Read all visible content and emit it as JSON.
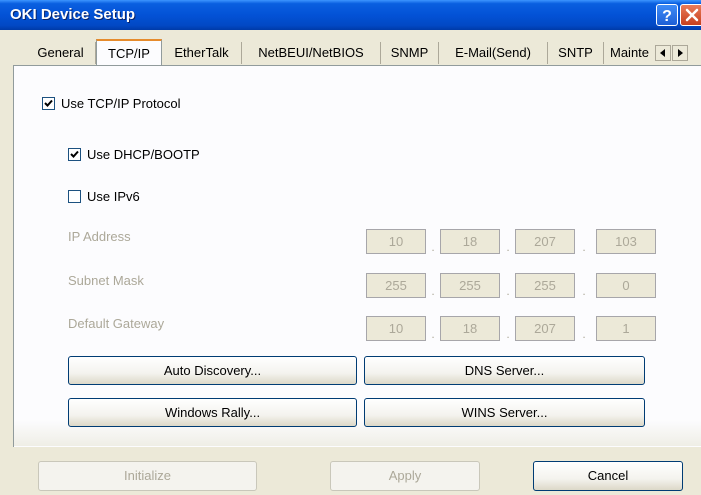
{
  "window": {
    "title": "OKI Device Setup"
  },
  "tabs": [
    "General",
    "TCP/IP",
    "EtherTalk",
    "NetBEUI/NetBIOS",
    "SNMP",
    "E-Mail(Send)",
    "SNTP",
    "Mainte"
  ],
  "active_tab": "TCP/IP",
  "checkboxes": {
    "use_tcpip": {
      "label": "Use TCP/IP Protocol",
      "checked": true
    },
    "use_dhcp": {
      "label": "Use DHCP/BOOTP",
      "checked": true
    },
    "use_ipv6": {
      "label": "Use IPv6",
      "checked": false
    }
  },
  "fields": {
    "ip_address": {
      "label": "IP Address",
      "octets": [
        "10",
        "18",
        "207",
        "103"
      ]
    },
    "subnet_mask": {
      "label": "Subnet Mask",
      "octets": [
        "255",
        "255",
        "255",
        "0"
      ]
    },
    "default_gateway": {
      "label": "Default Gateway",
      "octets": [
        "10",
        "18",
        "207",
        "1"
      ]
    }
  },
  "buttons": {
    "auto_discovery": "Auto Discovery...",
    "dns_server": "DNS Server...",
    "windows_rally": "Windows Rally...",
    "wins_server": "WINS Server...",
    "initialize": "Initialize",
    "apply": "Apply",
    "cancel": "Cancel"
  },
  "colors": {
    "titlebar": "#0352d6",
    "dialog_bg": "#ece9d8",
    "panel_bg": "#fcfcfe",
    "disabled_text": "#aca899",
    "active_tab_accent": "#e68b2c"
  }
}
